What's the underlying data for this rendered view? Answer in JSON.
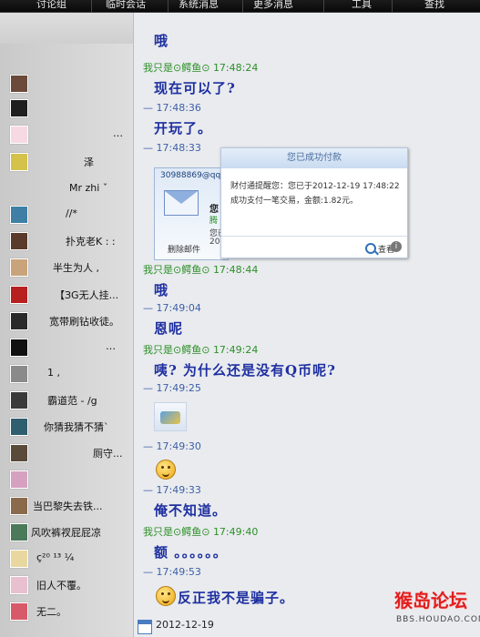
{
  "tabs": [
    "讨论组",
    "临时会话",
    "系统消息",
    "更多消息",
    "工具",
    "查找"
  ],
  "contacts": [
    {
      "name": "",
      "avatar_color": "#6b4a3a"
    },
    {
      "name": "",
      "avatar_color": "#1f1f1f"
    },
    {
      "name": "…",
      "avatar_color": "#f7d9e3"
    },
    {
      "name": "泽",
      "avatar_color": "#d4c24b"
    },
    {
      "name": "Mr  zhi ˇ",
      "avatar_color": "#cfcfcf"
    },
    {
      "name": "//*",
      "avatar_color": "#3f7fa6"
    },
    {
      "name": "扑克老K : :",
      "avatar_color": "#5a3b2b"
    },
    {
      "name": "半生为人   ,",
      "avatar_color": "#c9a37a"
    },
    {
      "name": "【ЗG无人挂...",
      "avatar_color": "#b82020"
    },
    {
      "name": "宽带刷钻收徒。",
      "avatar_color": "#2a2a2a"
    },
    {
      "name": "…",
      "avatar_color": "#111111"
    },
    {
      "name": "1 ,",
      "avatar_color": "#8a8a8a"
    },
    {
      "name": "霸道范 - /g",
      "avatar_color": "#3a3a3a"
    },
    {
      "name": "你猜我猜不猜ˋ",
      "avatar_color": "#2f5f6f"
    },
    {
      "name": "厕守...",
      "avatar_color": "#5a4a3a"
    },
    {
      "name": "",
      "avatar_color": "#d6a0c0"
    },
    {
      "name": "当巴黎失去铁...",
      "avatar_color": "#8a6a4a"
    },
    {
      "name": "风吹裤衩屁屁凉",
      "avatar_color": "#4a7a5a"
    },
    {
      "name": "ç²⁰ ¹³ ¼",
      "avatar_color": "#e8d8a0"
    },
    {
      "name": "旧人不覆。",
      "avatar_color": "#e8c0d0"
    },
    {
      "name": "无二。",
      "avatar_color": "#d85a6a"
    }
  ],
  "messages": [
    {
      "kind": "body",
      "text": "哦"
    },
    {
      "kind": "head",
      "sender": "我只是⊙鳄鱼⊙",
      "time": "17:48:24"
    },
    {
      "kind": "body",
      "text": "现在可以了?"
    },
    {
      "kind": "head",
      "sender": "",
      "time": "17:48:36"
    },
    {
      "kind": "body",
      "text": "开玩了。"
    },
    {
      "kind": "head",
      "sender": "",
      "time": "17:48:33"
    },
    {
      "kind": "head",
      "sender": "我只是⊙鳄鱼⊙",
      "time": "17:48:44"
    },
    {
      "kind": "body",
      "text": "哦"
    },
    {
      "kind": "head",
      "sender": "",
      "time": "17:49:04"
    },
    {
      "kind": "body",
      "text": "恩呢"
    },
    {
      "kind": "head",
      "sender": "我只是⊙鳄鱼⊙",
      "time": "17:49:24"
    },
    {
      "kind": "body",
      "text": "咦? 为什么还是没有Q币呢?"
    },
    {
      "kind": "head",
      "sender": "",
      "time": "17:49:25"
    },
    {
      "kind": "head",
      "sender": "",
      "time": "17:49:30"
    },
    {
      "kind": "head",
      "sender": "",
      "time": "17:49:33"
    },
    {
      "kind": "body",
      "text": "俺不知道。"
    },
    {
      "kind": "head",
      "sender": "我只是⊙鳄鱼⊙",
      "time": "17:49:40"
    },
    {
      "kind": "body",
      "text": "额 。。。。。。"
    },
    {
      "kind": "head",
      "sender": "",
      "time": "17:49:53"
    },
    {
      "kind": "body",
      "text": "反正我不是骗子。"
    }
  ],
  "popup": {
    "title": "您已成功付款",
    "line1": "财付通提醒您：您已于2012-12-19 17:48:22",
    "line2": "成功支付一笔交易，金额:1.82元。",
    "search": "查看",
    "back_addr": "30988869@qq.co",
    "back_l1": "您",
    "back_l2": "腾",
    "back_l3": "您已",
    "back_l4": "2012",
    "back_del": "删除邮件"
  },
  "footer_date": "2012-12-19",
  "watermark": {
    "text": "猴岛论坛",
    "sub": "BBS.HOUDAO.COM"
  }
}
